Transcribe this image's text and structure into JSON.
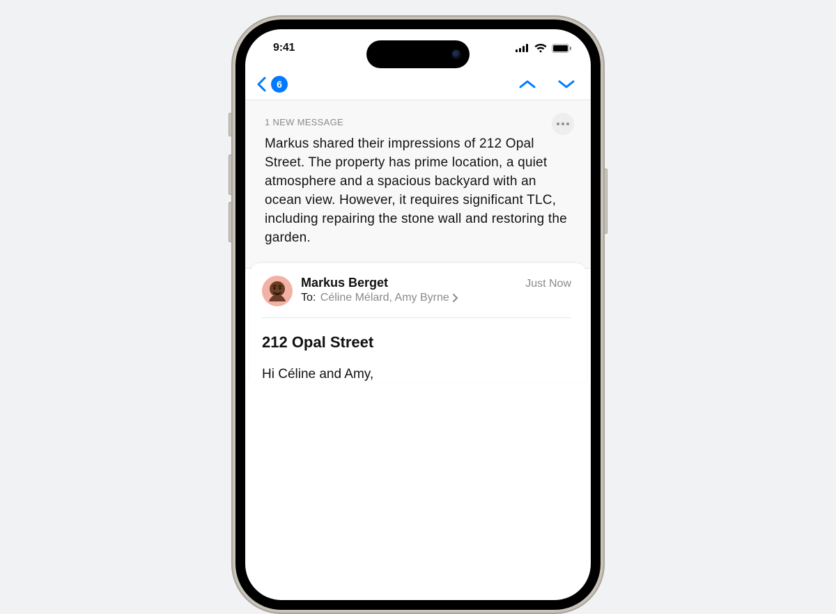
{
  "status": {
    "time": "9:41"
  },
  "nav": {
    "unread_count": "6"
  },
  "summary": {
    "header": "1 NEW MESSAGE",
    "body": "Markus shared their impressions of 212 Opal Street. The property has prime location, a quiet atmosphere and a spacious backyard with an ocean view. However, it requires significant TLC, including repairing the stone wall and restoring the garden."
  },
  "message": {
    "sender": "Markus Berget",
    "timestamp": "Just Now",
    "to_label": "To:",
    "recipients": "Céline Mélard, Amy Byrne",
    "subject": "212 Opal Street",
    "body_first_line": "Hi Céline and Amy,"
  }
}
